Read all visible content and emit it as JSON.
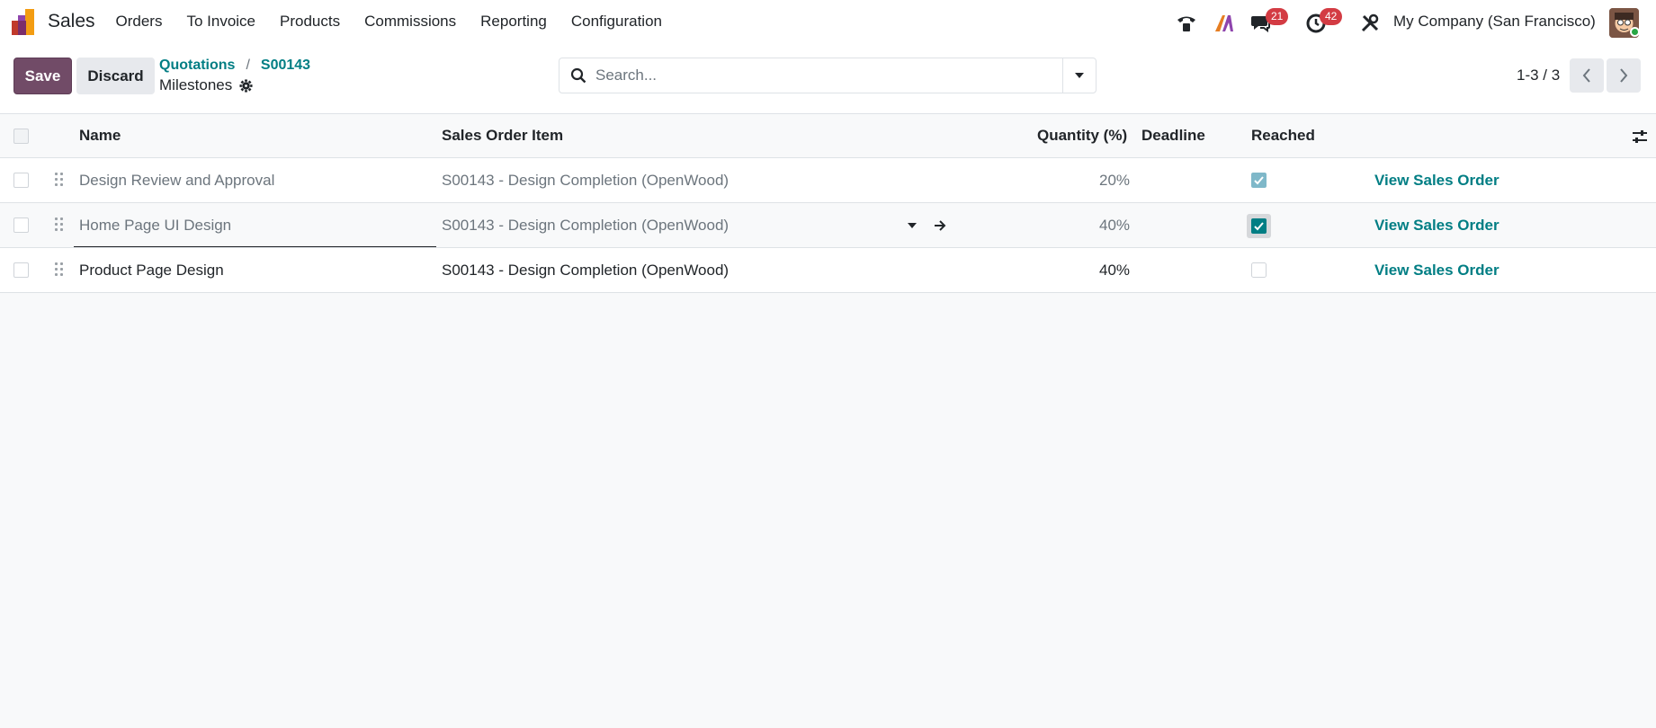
{
  "navbar": {
    "app_name": "Sales",
    "menu": [
      "Orders",
      "To Invoice",
      "Products",
      "Commissions",
      "Reporting",
      "Configuration"
    ],
    "messages_badge": "21",
    "activities_badge": "42",
    "company": "My Company (San Francisco)"
  },
  "control": {
    "save_label": "Save",
    "discard_label": "Discard",
    "breadcrumb": [
      "Quotations",
      "S00143"
    ],
    "title": "Milestones",
    "search_placeholder": "Search...",
    "pager": "1-3 / 3"
  },
  "table": {
    "headers": {
      "name": "Name",
      "sale_line": "Sales Order Item",
      "quantity": "Quantity (%)",
      "deadline": "Deadline",
      "reached": "Reached"
    },
    "rows": [
      {
        "name": "Design Review and Approval",
        "sale_line": "S00143 - Design Completion (OpenWood)",
        "quantity": "20%",
        "deadline": "",
        "reached": true,
        "action": "View Sales Order"
      },
      {
        "name": "Home Page UI Design",
        "sale_line": "S00143 - Design Completion (OpenWood)",
        "quantity": "40%",
        "deadline": "",
        "reached": true,
        "action": "View Sales Order"
      },
      {
        "name": "Product Page Design",
        "sale_line": "S00143 - Design Completion (OpenWood)",
        "quantity": "40%",
        "deadline": "",
        "reached": false,
        "action": "View Sales Order"
      }
    ]
  },
  "colors": {
    "primary": "#714b67",
    "link": "#017e84",
    "badge": "#d33b43"
  }
}
